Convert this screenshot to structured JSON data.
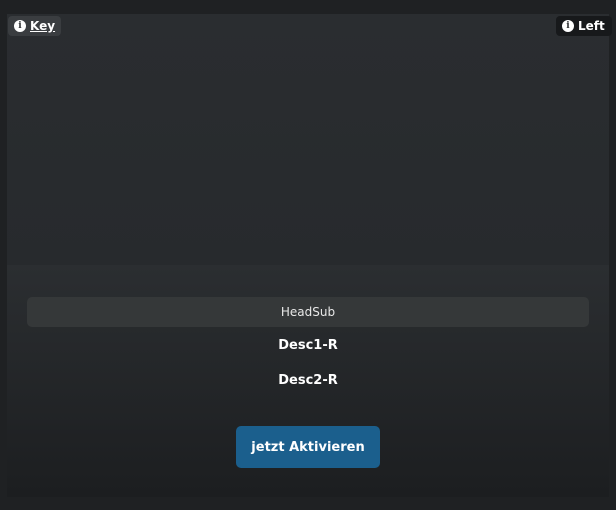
{
  "badges": {
    "key_label": "Key",
    "left_label": "Left",
    "icon": "info-icon"
  },
  "panel": {
    "head_sub": "HeadSub",
    "desc1": "Desc1-R",
    "desc2": "Desc2-R",
    "cta_label": "jetzt Aktivieren"
  },
  "colors": {
    "background": "#1f2123",
    "card": "#232629",
    "button": "#1b5f8d",
    "text": "#ffffff"
  }
}
